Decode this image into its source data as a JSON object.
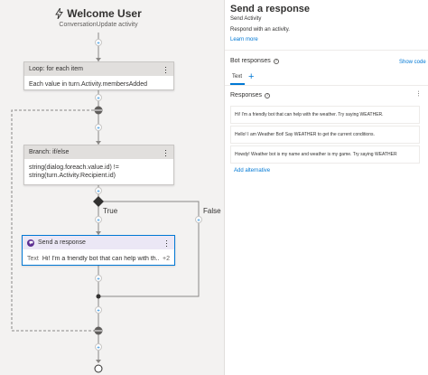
{
  "trigger": {
    "title": "Welcome User",
    "subtitle": "ConversationUpdate activity",
    "icon": "lightning-icon"
  },
  "loop_node": {
    "header": "Loop: for each item",
    "body": "Each value in turn.Activity.membersAdded"
  },
  "branch_node": {
    "header": "Branch: if/else",
    "body_line1": "string(dialog.foreach.value.id) !=",
    "body_line2": "string(turn.Activity.Recipient.id)"
  },
  "branch_labels": {
    "true_label": "True",
    "false_label": "False"
  },
  "send_node": {
    "header": "Send a response",
    "field_label": "Text",
    "field_value": "Hi! I'm a friendly bot that can help with th...",
    "extra_count": "+2"
  },
  "panel": {
    "title": "Send a response",
    "subtitle": "Send Activity",
    "description": "Respond with an activity.",
    "learn_more": "Learn more",
    "bot_responses_label": "Bot responses",
    "show_code": "Show code",
    "tab_text": "Text",
    "responses_label": "Responses",
    "responses": [
      "Hi! I'm a friendly bot that can help with the weather. Try saying WEATHER.",
      "Hello! I am Weather Bot! Say WEATHER to get the current conditions.",
      "Howdy! Weather bot is my name and weather is my game. Try saying WEATHER"
    ],
    "add_alternative": "Add alternative"
  },
  "colors": {
    "accent": "#0078d4",
    "canvas_bg": "#f3f2f1",
    "node_header": "#e1dfdd",
    "send_header": "#ebe7f5",
    "send_icon": "#5c2d91"
  }
}
